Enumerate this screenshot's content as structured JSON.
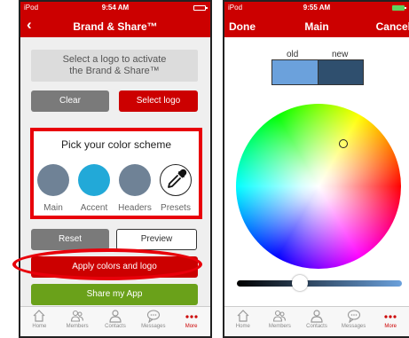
{
  "left": {
    "status": {
      "carrier": "iPod",
      "time": "9:54 AM"
    },
    "nav": {
      "back": "‹",
      "title": "Brand & Share™"
    },
    "logo_prompt": {
      "line1": "Select a logo to activate",
      "line2": "the Brand & Share™"
    },
    "clear_label": "Clear",
    "select_logo_label": "Select logo",
    "scheme": {
      "title": "Pick your color scheme",
      "swatches": [
        {
          "label": "Main",
          "color": "#6f8296"
        },
        {
          "label": "Accent",
          "color": "#22a9d8"
        },
        {
          "label": "Headers",
          "color": "#6f8296"
        },
        {
          "label": "Presets",
          "icon": "eyedropper-icon"
        }
      ]
    },
    "reset_label": "Reset",
    "preview_label": "Preview",
    "apply_label": "Apply colors and logo",
    "share_label": "Share my App"
  },
  "right": {
    "status": {
      "carrier": "iPod",
      "time": "9:55 AM"
    },
    "nav": {
      "done": "Done",
      "title": "Main",
      "cancel": "Cancel"
    },
    "compare": {
      "old_label": "old",
      "new_label": "new",
      "old_color": "#6ba1dc",
      "new_color": "#2f4f6e"
    }
  },
  "tabs": [
    {
      "label": "Home",
      "icon": "home-icon"
    },
    {
      "label": "Members",
      "icon": "members-icon"
    },
    {
      "label": "Contacts",
      "icon": "contacts-icon"
    },
    {
      "label": "Messages",
      "icon": "messages-icon"
    },
    {
      "label": "More",
      "icon": "more-icon",
      "active": true
    }
  ],
  "colors": {
    "brand_red": "#cc0000",
    "highlight_red": "#e8000a",
    "green": "#6aa11a"
  }
}
